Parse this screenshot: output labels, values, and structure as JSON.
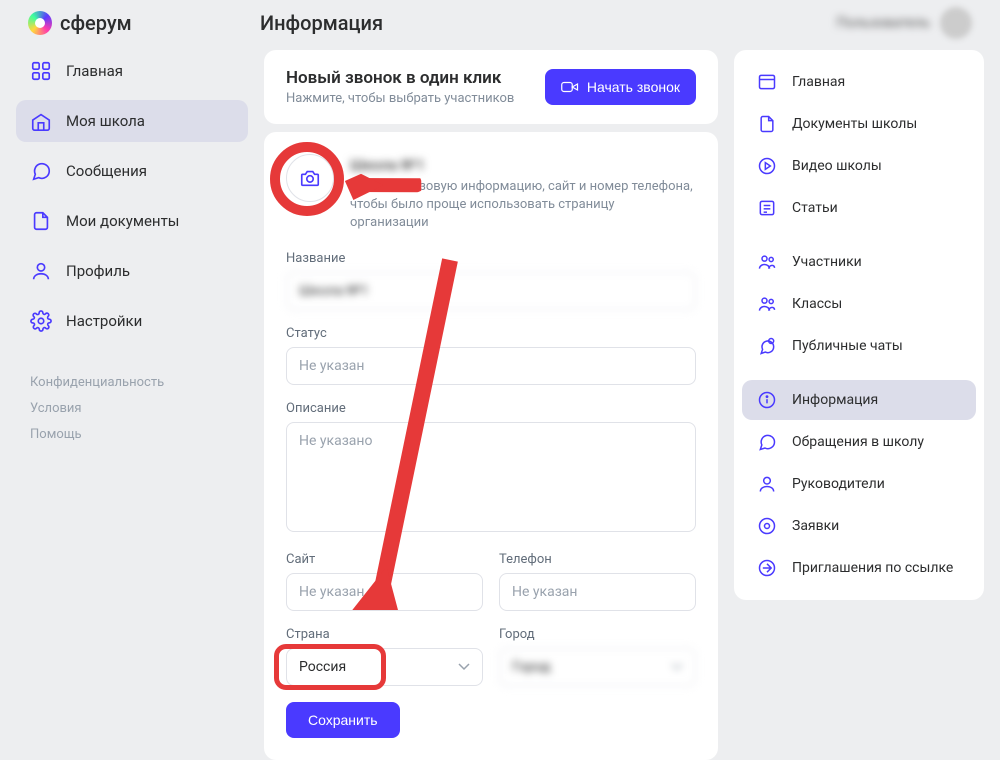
{
  "header": {
    "logo_text": "сферум",
    "page_title": "Информация",
    "user_name": "Пользователь"
  },
  "left_nav": {
    "items": [
      {
        "label": "Главная",
        "icon": "grid",
        "active": false
      },
      {
        "label": "Моя школа",
        "icon": "school",
        "active": true
      },
      {
        "label": "Сообщения",
        "icon": "message",
        "active": false
      },
      {
        "label": "Мои документы",
        "icon": "document",
        "active": false
      },
      {
        "label": "Профиль",
        "icon": "user",
        "active": false
      },
      {
        "label": "Настройки",
        "icon": "gear",
        "active": false
      }
    ],
    "footer": {
      "privacy": "Конфиденциальность",
      "terms": "Условия",
      "help": "Помощь"
    }
  },
  "call_card": {
    "title": "Новый звонок в один клик",
    "subtitle": "Нажмите, чтобы выбрать участников",
    "button": "Начать звонок"
  },
  "info_form": {
    "school_name": "Школа №1",
    "help_text": "Укажите базовую информацию, сайт и номер телефона, чтобы было проще использовать страницу организации",
    "labels": {
      "name": "Название",
      "status": "Статус",
      "description": "Описание",
      "site": "Сайт",
      "phone": "Телефон",
      "country": "Страна",
      "city": "Город"
    },
    "values": {
      "name": "Школа №1",
      "country": "Россия",
      "city": "Город"
    },
    "placeholders": {
      "status": "Не указан",
      "description": "Не указано",
      "site": "Не указан",
      "phone": "Не указан"
    },
    "save_button": "Сохранить"
  },
  "right_nav": {
    "group1": [
      {
        "label": "Главная",
        "icon": "window"
      },
      {
        "label": "Документы школы",
        "icon": "document"
      },
      {
        "label": "Видео школы",
        "icon": "play"
      },
      {
        "label": "Статьи",
        "icon": "article"
      }
    ],
    "group2": [
      {
        "label": "Участники",
        "icon": "users"
      },
      {
        "label": "Классы",
        "icon": "users"
      },
      {
        "label": "Публичные чаты",
        "icon": "chat"
      }
    ],
    "group3": [
      {
        "label": "Информация",
        "icon": "info",
        "active": true
      },
      {
        "label": "Обращения в школу",
        "icon": "message"
      },
      {
        "label": "Руководители",
        "icon": "user"
      },
      {
        "label": "Заявки",
        "icon": "circle"
      },
      {
        "label": "Приглашения по ссылке",
        "icon": "link"
      }
    ]
  }
}
